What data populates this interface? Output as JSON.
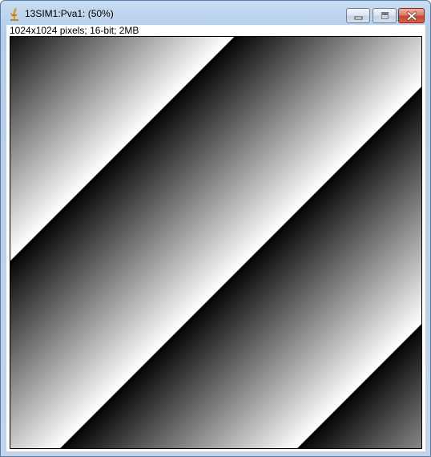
{
  "window": {
    "title": "13SIM1:Pva1: (50%)",
    "app_icon": "imagej-microscope-icon",
    "controls": {
      "minimize_icon": "minimize-icon",
      "maximize_icon": "maximize-icon",
      "close_icon": "close-icon"
    }
  },
  "image": {
    "info": "1024x1024 pixels; 16-bit; 2MB",
    "zoom": "50%",
    "content": "diagonal grayscale ramp stripes (phase image)"
  }
}
